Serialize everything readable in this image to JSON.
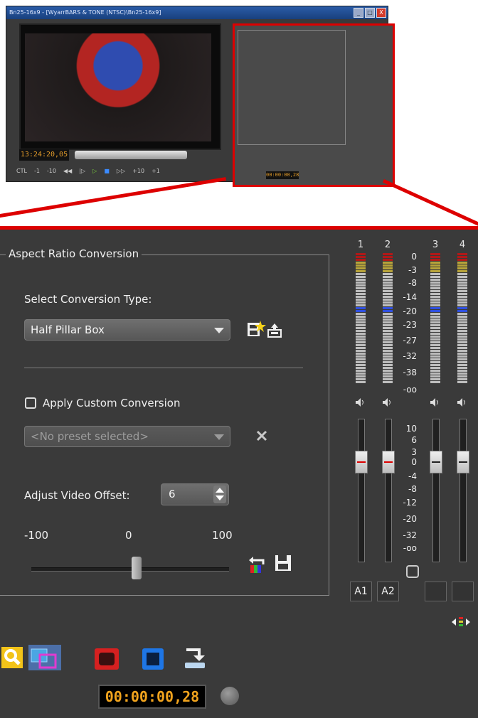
{
  "window": {
    "title": "Bn25-16x9 - [WyarrBARS & TONE (NTSC)\\Bn25-16x9]",
    "controls": [
      "_",
      "□",
      "X"
    ]
  },
  "player": {
    "timecode": "13:24:20,05",
    "ctl_label": "CTL",
    "transport": [
      "-1",
      "-10",
      "◀◀",
      "|▷",
      "▷",
      "■",
      "▷▷",
      "+10",
      "+1"
    ]
  },
  "aspect": {
    "group_title": "Aspect Ratio Conversion",
    "select_label": "Select Conversion Type:",
    "conversion_type": "Half Pillar Box",
    "apply_custom_label": "Apply Custom Conversion",
    "apply_custom_checked": false,
    "preset_value": "<No preset selected>",
    "offset_label": "Adjust Video Offset:",
    "offset_value": "6",
    "slider_min": "-100",
    "slider_mid": "0",
    "slider_max": "100",
    "slider_value": 6
  },
  "meters": {
    "channels": [
      "1",
      "2",
      "3",
      "4"
    ],
    "db_scale": [
      "0",
      "-3",
      "-8",
      "-14",
      "-20",
      "-23",
      "-27",
      "-32",
      "-38",
      "-oo"
    ],
    "fader_scale": [
      "10",
      "6",
      "3",
      "0",
      "-4",
      "-8",
      "-12",
      "-20",
      "-32",
      "-oo"
    ],
    "assignments": [
      "A1",
      "A2",
      "",
      ""
    ],
    "colors": {
      "peak": "#b01818",
      "warn": "#b8a43a",
      "ref": "#2f4fe0",
      "normal": "#bdbdbd"
    }
  },
  "footer": {
    "timecode": "00:00:00,28"
  },
  "icons": {
    "search": "search-icon",
    "overlay": "overlay-icon",
    "record": "record-icon",
    "stop": "stop-icon",
    "output": "output-icon",
    "preset_add": "preset-add-icon",
    "export": "export-icon",
    "clear": "close-icon",
    "reset": "reset-icon",
    "save": "save-icon"
  }
}
